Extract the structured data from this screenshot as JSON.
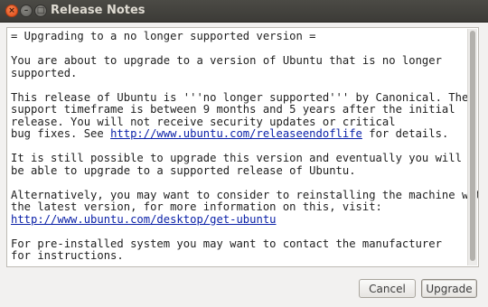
{
  "window": {
    "title": "Release Notes",
    "controls": {
      "close": "×",
      "minimize": "–",
      "maximize": "□"
    }
  },
  "notes": {
    "heading": "= Upgrading to a no longer supported version =",
    "p1": "You are about to upgrade to a version of Ubuntu that is no longer\nsupported.",
    "p2_pre": "This release of Ubuntu is '''no longer supported''' by Canonical. The\nsupport timeframe is between 9 months and 5 years after the initial\nrelease. You will not receive security updates or critical\nbug fixes. See ",
    "p2_link": "http://www.ubuntu.com/releaseendoflife",
    "p2_post": " for details.",
    "p3": "It is still possible to upgrade this version and eventually you will\nbe able to upgrade to a supported release of Ubuntu.",
    "p4": "Alternatively, you may want to consider to reinstalling the machine with\nthe latest version, for more information on this, visit:",
    "p4_link": "http://www.ubuntu.com/desktop/get-ubuntu",
    "p5": "For pre-installed system you may want to contact the manufacturer\nfor instructions."
  },
  "buttons": {
    "cancel": "Cancel",
    "upgrade": "Upgrade"
  }
}
